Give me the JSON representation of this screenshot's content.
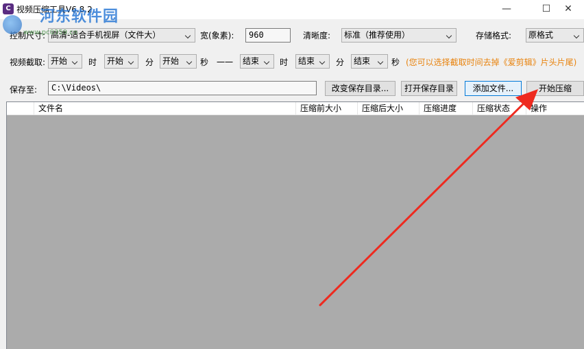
{
  "window": {
    "title": "视频压缩工具V6.8.2",
    "app_icon_glyph": "C",
    "minimize_glyph": "—",
    "maximize_glyph": "☐",
    "close_glyph": "✕"
  },
  "watermark": {
    "brand": "河东软件园",
    "url": "www.pc0359.cn"
  },
  "row1": {
    "size_label": "控制尺寸:",
    "size_value": "高清-适合手机视屏（文件大）",
    "width_label": "宽(象素):",
    "width_value": "960",
    "clarity_label": "清晰度:",
    "clarity_value": "标准（推荐使用）",
    "format_label": "存储格式:",
    "format_value": "原格式"
  },
  "row2": {
    "clip_label": "视频截取:",
    "start_hour": "开始",
    "hour_unit": "时",
    "start_min": "开始",
    "min_unit": "分",
    "start_sec": "开始",
    "sec_unit": "秒",
    "dash": "一一",
    "end_hour": "结束",
    "end_min": "结束",
    "end_sec": "结束",
    "hint": "(您可以选择截取时间去掉《爱剪辑》片头片尾)"
  },
  "row3": {
    "save_label": "保存至:",
    "save_path": "C:\\Videos\\",
    "change_dir_btn": "改变保存目录...",
    "open_dir_btn": "打开保存目录",
    "add_file_btn": "添加文件...",
    "start_btn": "开始压缩"
  },
  "table": {
    "columns": [
      "文件名",
      "压缩前大小",
      "压缩后大小",
      "压缩进度",
      "压缩状态",
      "操作"
    ]
  },
  "colors": {
    "hint": "#e8820c",
    "arrow": "#ee2a1f",
    "list_bg": "#ababab"
  }
}
